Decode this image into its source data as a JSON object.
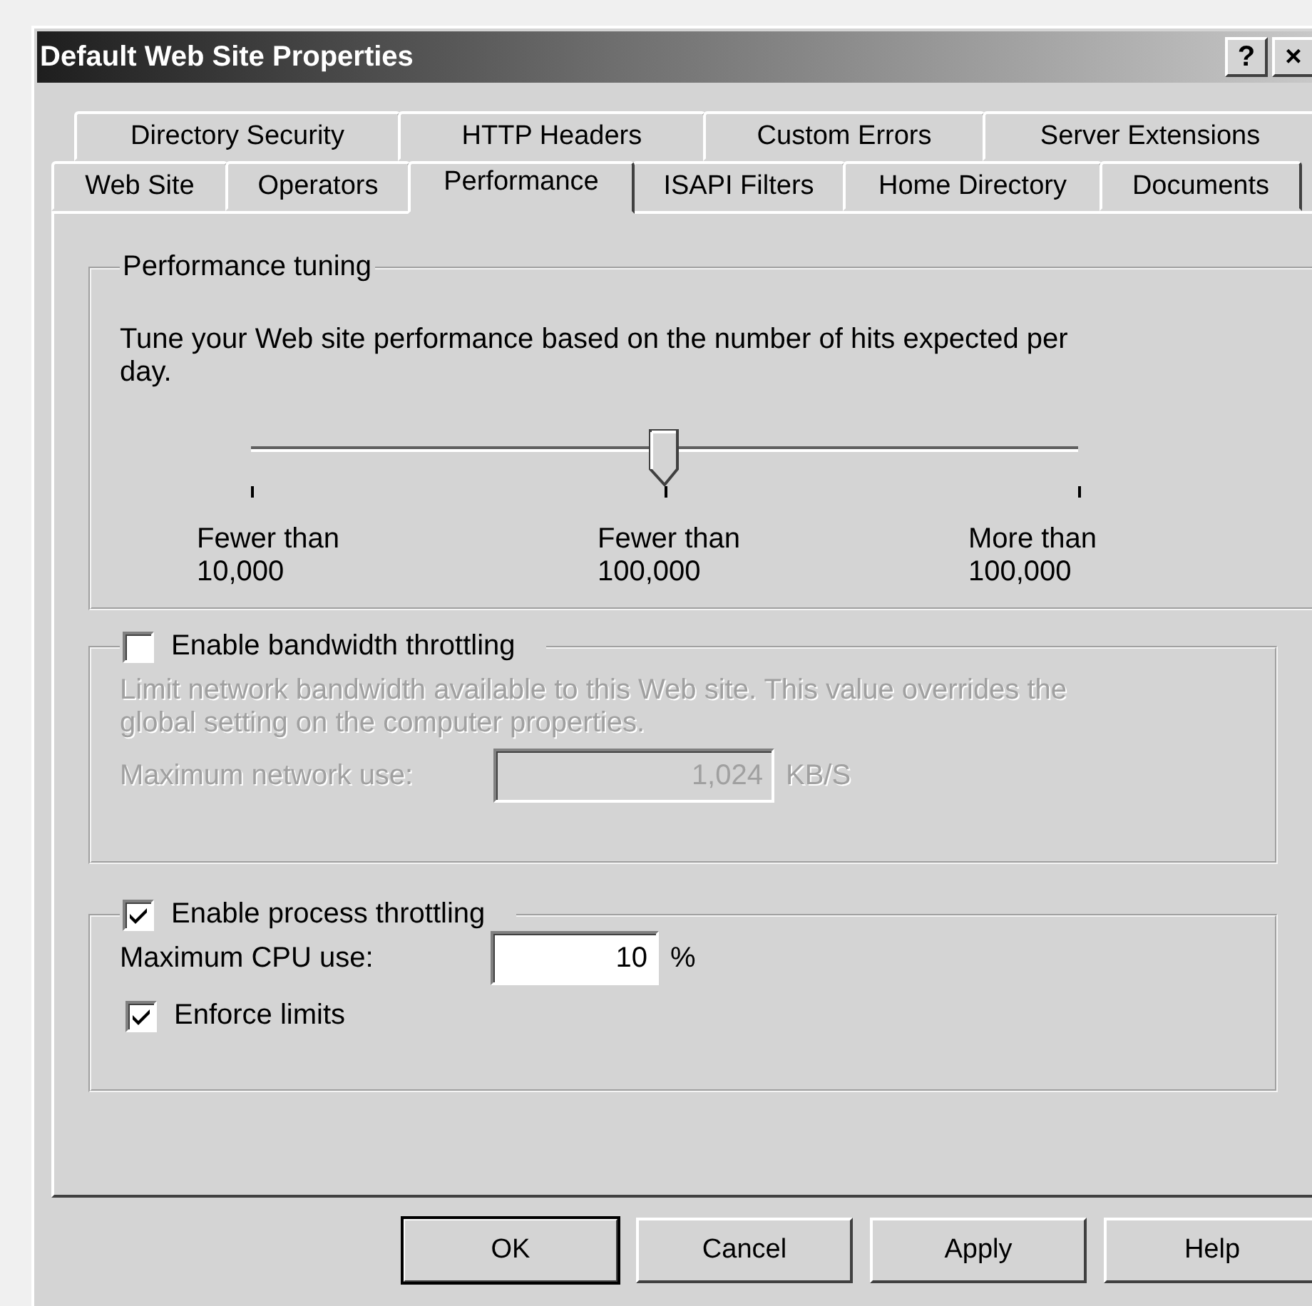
{
  "window": {
    "title": "Default Web Site Properties",
    "title_buttons": [
      "?",
      "×"
    ]
  },
  "tab_rows": [
    {
      "tabs": [
        {
          "label": "Directory Security",
          "selected": false
        },
        {
          "label": "HTTP Headers",
          "selected": false
        },
        {
          "label": "Custom Errors",
          "selected": false
        },
        {
          "label": "Server Extensions",
          "selected": false
        }
      ]
    },
    {
      "tabs": [
        {
          "label": "Web Site",
          "selected": false
        },
        {
          "label": "Operators",
          "selected": false
        },
        {
          "label": "Performance",
          "selected": true
        },
        {
          "label": "ISAPI Filters",
          "selected": false
        },
        {
          "label": "Home Directory",
          "selected": false
        },
        {
          "label": "Documents",
          "selected": false
        }
      ]
    }
  ],
  "performance_tuning": {
    "title": "Performance tuning",
    "description": "Tune your Web site performance based on the number of hits expected per day.",
    "slider": {
      "level": 0.5
    },
    "scale_labels": [
      {
        "lines": [
          "Fewer than",
          "10,000"
        ]
      },
      {
        "lines": [
          "Fewer than",
          "100,000"
        ]
      },
      {
        "lines": [
          "More than",
          "100,000"
        ]
      }
    ]
  },
  "bandwidth_throttling": {
    "label": "Enable bandwidth throttling",
    "checked": false,
    "description": "Limit network bandwidth available to this Web site.  This value overrides the global setting on the computer properties.",
    "field_label": "Maximum network use:",
    "value": "1,024",
    "unit": "KB/S"
  },
  "process_throttling": {
    "label": "Enable process throttling",
    "checked": true,
    "field_label": "Maximum CPU use:",
    "value": "10",
    "unit": "%",
    "enforce_limits": {
      "label": "Enforce limits",
      "checked": true
    }
  },
  "buttons": [
    {
      "label": "OK",
      "default": true
    },
    {
      "label": "Cancel",
      "default": false
    },
    {
      "label": "Apply",
      "default": false
    },
    {
      "label": "Help",
      "default": false
    }
  ]
}
